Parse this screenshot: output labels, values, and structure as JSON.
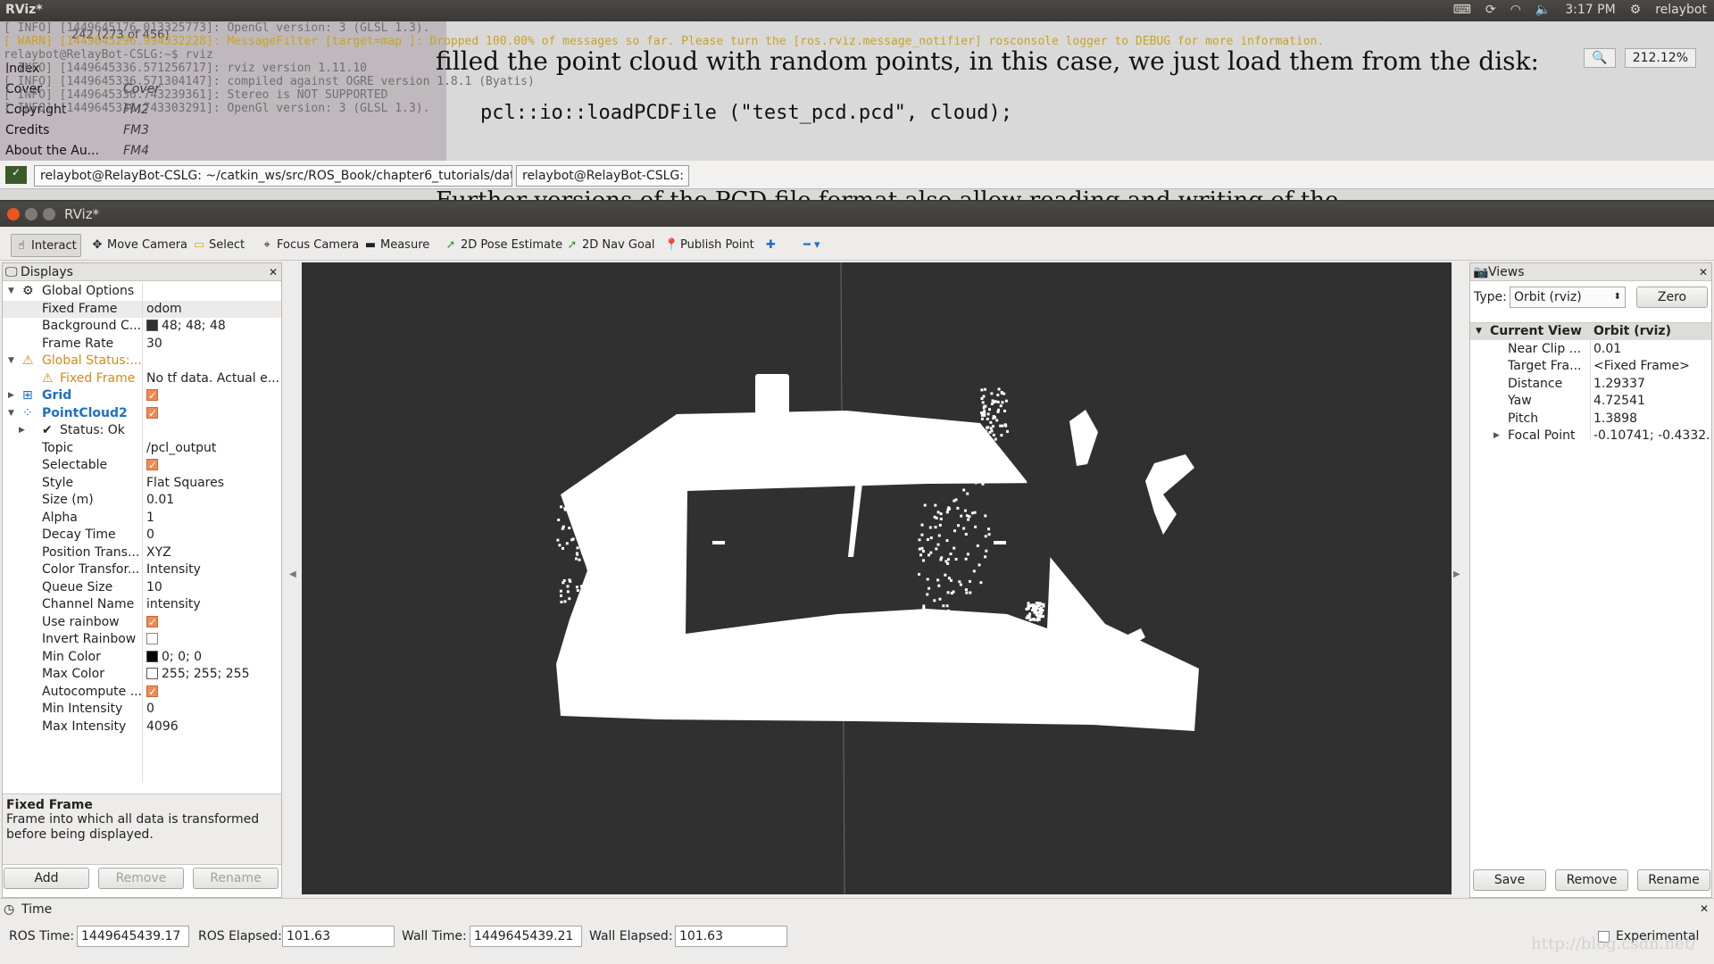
{
  "topbar": {
    "title": "RViz*",
    "time": "3:17 PM",
    "user": "relaybot"
  },
  "background": {
    "terminal_lines": [
      "[ INFO] [1449645176.013325773]: OpenGl version: 3 (GLSL 1.3).",
      "[ WARN] [1449645296.994332228]: MessageFilter [target=map ]: Dropped 100.00% of messages so far. Please turn the [ros.rviz.message_notifier] rosconsole logger to DEBUG for more information.",
      "relaybot@RelayBot-CSLG:~$ rviz",
      "[ INFO] [1449645336.571256717]: rviz version 1.11.10",
      "[ INFO] [1449645336.571304147]: compiled against OGRE version 1.8.1 (Byatis)",
      "[ INFO] [1449645336.743239361]: Stereo is NOT SUPPORTED",
      "[ INFO] [1449645336.743303291]: OpenGl version: 3 (GLSL 1.3)."
    ],
    "doc_line1": "filled the point cloud with random points, in this case, we just load them from the disk:",
    "doc_code": "pcl::io::loadPCDFile (\"test_pcd.pcd\", cloud);",
    "doc_line3": "Further versions of the PCD file format also allow reading and writing of the",
    "page_info": "242 (273 of 456)",
    "zoom": "212.12%",
    "toc": [
      {
        "label": "Index",
        "key": ""
      },
      {
        "label": "Cover",
        "key": "Cover"
      },
      {
        "label": "Copyright",
        "key": "FM2"
      },
      {
        "label": "Credits",
        "key": "FM3"
      },
      {
        "label": "About the Au...",
        "key": "FM4"
      }
    ]
  },
  "taskbar": {
    "tab1": "relaybot@RelayBot-CSLG: ~/catkin_ws/src/ROS_Book/chapter6_tutorials/data",
    "tab2": "relaybot@RelayBot-CSLG: ~"
  },
  "window": {
    "title": "RViz*"
  },
  "toolbar": {
    "interact": "Interact",
    "move_camera": "Move Camera",
    "select": "Select",
    "focus_camera": "Focus Camera",
    "measure": "Measure",
    "pose_estimate": "2D Pose Estimate",
    "nav_goal": "2D Nav Goal",
    "publish_point": "Publish Point"
  },
  "displays": {
    "title": "Displays",
    "rows": [
      {
        "k": "Global Options",
        "v": "",
        "indent": 1,
        "arrow": "▼",
        "icon": "gear-icon",
        "color": "#222"
      },
      {
        "k": "Fixed Frame",
        "v": "odom",
        "indent": 2,
        "selected": true
      },
      {
        "k": "Background C...",
        "v": "48; 48; 48",
        "indent": 2,
        "swatch": "#303030"
      },
      {
        "k": "Frame Rate",
        "v": "30",
        "indent": 2
      },
      {
        "k": "Global Status:...",
        "v": "",
        "indent": 1,
        "arrow": "▼",
        "icon": "warning-icon",
        "color": "#d48a18"
      },
      {
        "k": "Fixed Frame",
        "v": "No tf data.  Actual e...",
        "indent": 2,
        "icon": "warning-icon",
        "color": "#d48a18"
      },
      {
        "k": "Grid",
        "v": "",
        "indent": 1,
        "arrow": "▶",
        "icon": "grid-icon",
        "color": "#1f6fc8",
        "check": true,
        "bold": true
      },
      {
        "k": "PointCloud2",
        "v": "",
        "indent": 1,
        "arrow": "▼",
        "icon": "pointcloud-icon",
        "color": "#1f6fc8",
        "check": true,
        "bold": true
      },
      {
        "k": "Status: Ok",
        "v": "",
        "indent": 2,
        "arrow": "▶",
        "icon": "check-icon",
        "color": "#222"
      },
      {
        "k": "Topic",
        "v": "/pcl_output",
        "indent": 2
      },
      {
        "k": "Selectable",
        "v": "",
        "indent": 2,
        "check": true
      },
      {
        "k": "Style",
        "v": "Flat Squares",
        "indent": 2
      },
      {
        "k": "Size (m)",
        "v": "0.01",
        "indent": 2
      },
      {
        "k": "Alpha",
        "v": "1",
        "indent": 2
      },
      {
        "k": "Decay Time",
        "v": "0",
        "indent": 2
      },
      {
        "k": "Position Trans...",
        "v": "XYZ",
        "indent": 2
      },
      {
        "k": "Color Transfor...",
        "v": "Intensity",
        "indent": 2
      },
      {
        "k": "Queue Size",
        "v": "10",
        "indent": 2
      },
      {
        "k": "Channel Name",
        "v": "intensity",
        "indent": 2
      },
      {
        "k": "Use rainbow",
        "v": "",
        "indent": 2,
        "check": true
      },
      {
        "k": "Invert Rainbow",
        "v": "",
        "indent": 2,
        "check": false
      },
      {
        "k": "Min Color",
        "v": "0; 0; 0",
        "indent": 2,
        "swatch": "#000000"
      },
      {
        "k": "Max Color",
        "v": "255; 255; 255",
        "indent": 2,
        "swatch": "#ffffff"
      },
      {
        "k": "Autocompute ...",
        "v": "",
        "indent": 2,
        "check": true
      },
      {
        "k": "Min Intensity",
        "v": "0",
        "indent": 2
      },
      {
        "k": "Max Intensity",
        "v": "4096",
        "indent": 2
      }
    ],
    "help_title": "Fixed Frame",
    "help_text": "Frame into which all data is transformed before being displayed.",
    "add": "Add",
    "remove": "Remove",
    "rename": "Rename"
  },
  "views": {
    "title": "Views",
    "type_label": "Type:",
    "type_value": "Orbit (rviz)",
    "zero": "Zero",
    "header_k": "Current View",
    "header_v": "Orbit (rviz)",
    "rows": [
      {
        "k": "Near Clip ...",
        "v": "0.01"
      },
      {
        "k": "Target Fra...",
        "v": "<Fixed Frame>"
      },
      {
        "k": "Distance",
        "v": "1.29337"
      },
      {
        "k": "Yaw",
        "v": "4.72541"
      },
      {
        "k": "Pitch",
        "v": "1.3898"
      },
      {
        "k": "Focal Point",
        "v": "-0.10741; -0.4332...",
        "arrow": true
      }
    ],
    "save": "Save",
    "remove": "Remove",
    "rename": "Rename"
  },
  "time": {
    "title": "Time",
    "ros_time_label": "ROS Time:",
    "ros_time": "1449645439.17",
    "ros_elapsed_label": "ROS Elapsed:",
    "ros_elapsed": "101.63",
    "wall_time_label": "Wall Time:",
    "wall_time": "1449645439.21",
    "wall_elapsed_label": "Wall Elapsed:",
    "wall_elapsed": "101.63",
    "experimental": "Experimental"
  },
  "watermark": "http://blog.csdn.net/",
  "colors": {
    "viewport_bg": "#303030",
    "accent_check": "#f08a55",
    "link_blue": "#1f6fc8",
    "warning": "#d48a18"
  }
}
